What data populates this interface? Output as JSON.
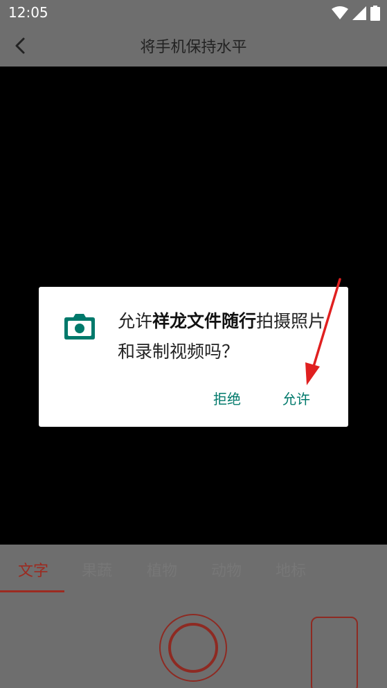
{
  "status_bar": {
    "time": "12:05",
    "icons": [
      "wifi-icon",
      "signal-icon",
      "battery-icon"
    ]
  },
  "header": {
    "title": "将手机保持水平",
    "back_icon": "chevron-left-icon"
  },
  "dialog": {
    "message_prefix": "允许",
    "app_name": "祥龙文件随行",
    "message_suffix": "拍摄照片和录制视频吗？",
    "deny_label": "拒绝",
    "allow_label": "允许",
    "icon": "camera-icon",
    "accent_color": "#00796b"
  },
  "tabs": [
    {
      "label": "文字",
      "active": true
    },
    {
      "label": "果蔬",
      "active": false
    },
    {
      "label": "植物",
      "active": false
    },
    {
      "label": "动物",
      "active": false
    },
    {
      "label": "地标",
      "active": false
    }
  ],
  "colors": {
    "overlay": "#6e6e6e",
    "accent_red": "#9c2a20",
    "annotation_arrow": "#e02020"
  }
}
